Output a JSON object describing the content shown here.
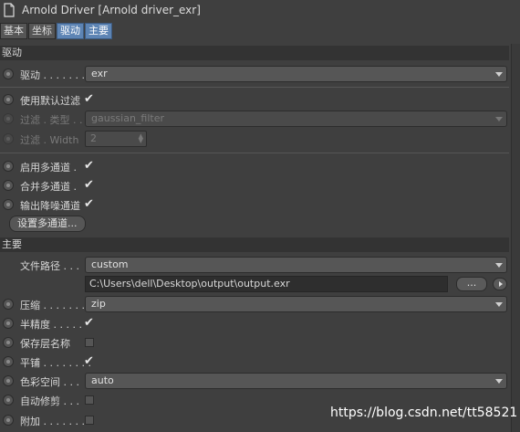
{
  "window": {
    "title": "Arnold Driver [Arnold driver_exr]"
  },
  "tabs": [
    {
      "label": "基本",
      "active": false
    },
    {
      "label": "坐标",
      "active": false
    },
    {
      "label": "驱动",
      "active": true
    },
    {
      "label": "主要",
      "active": true
    }
  ],
  "driver_section": {
    "title": "驱动",
    "driver": {
      "label": "驱动 . . . . . . . .",
      "value": "exr"
    },
    "use_default_filter": {
      "label": "使用默认过滤",
      "checked": true
    },
    "filter_type": {
      "label": "过滤 . 类型 . .",
      "value": "gaussian_filter",
      "enabled": false
    },
    "filter_width": {
      "label": "过滤 . Width",
      "value": "2",
      "enabled": false
    },
    "enable_multipass": {
      "label": "启用多通道 .",
      "checked": true
    },
    "merge_multipass": {
      "label": "合并多通道 .",
      "checked": true
    },
    "output_denoise": {
      "label": "输出降噪通道",
      "checked": true
    },
    "setup_multipass_button": "设置多通道..."
  },
  "main_section": {
    "title": "主要",
    "file_path": {
      "label": "文件路径 . . .",
      "mode": "custom",
      "path": "C:\\Users\\dell\\Desktop\\output\\output.exr"
    },
    "browse_button": "...",
    "compression": {
      "label": "压缩 . . . . . . . .",
      "value": "zip"
    },
    "half_precision": {
      "label": "半精度 . . . . .",
      "checked": true
    },
    "preserve_layer_name": {
      "label": "保存层名称",
      "checked": false
    },
    "tiled": {
      "label": "平铺 . . . . . . . .",
      "checked": true
    },
    "color_space": {
      "label": "色彩空间 . . .",
      "value": "auto"
    },
    "autocrop": {
      "label": "自动修剪 . . .",
      "checked": false
    },
    "append": {
      "label": "附加 . . . . . . . .",
      "checked": false
    }
  },
  "watermark": "https://blog.csdn.net/tt58521",
  "colors": {
    "background": "#3f3f3f",
    "tab_active": "#5d84b4",
    "section_header": "#333333",
    "field": "#565656"
  },
  "icons": [
    "document-icon",
    "radio-icon",
    "check-icon",
    "caret-down-icon",
    "play-arrow-icon"
  ]
}
